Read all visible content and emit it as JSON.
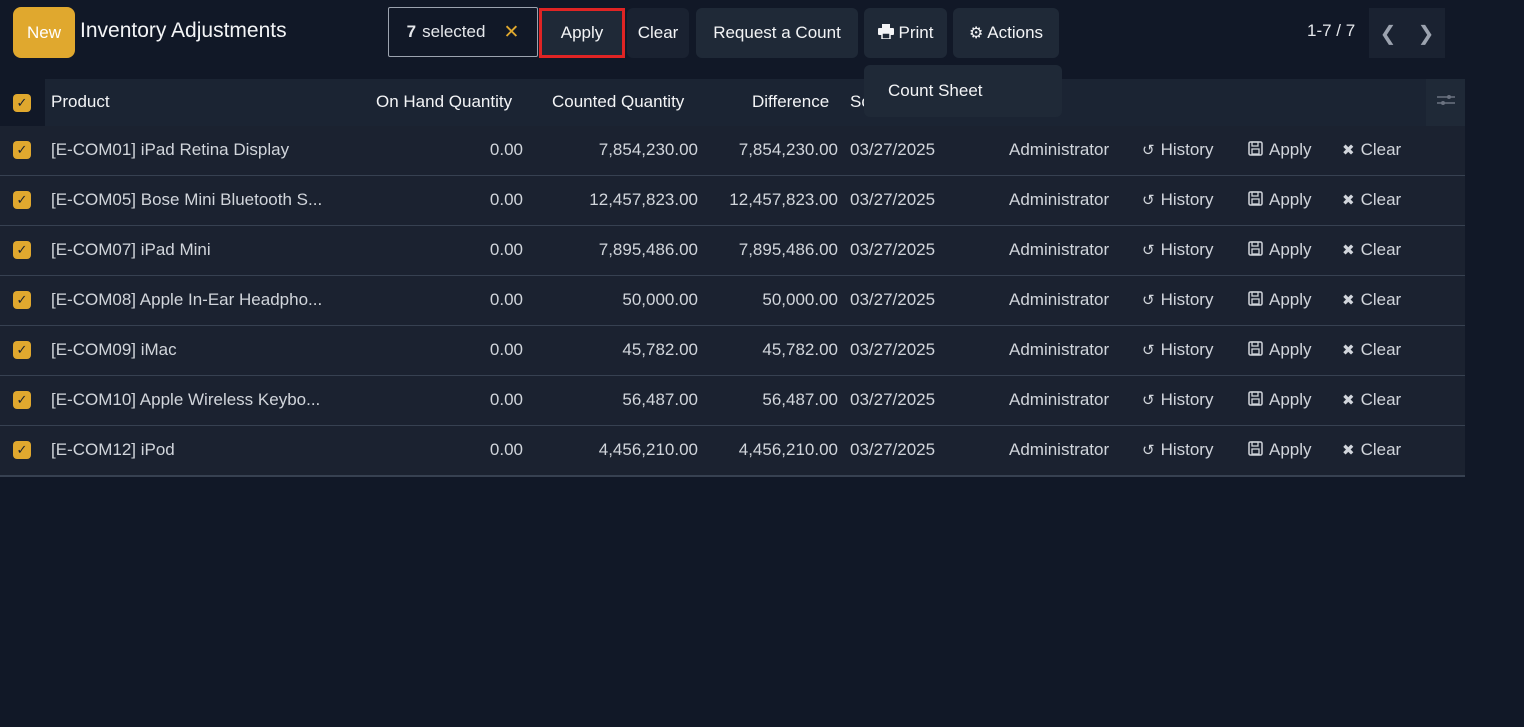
{
  "header": {
    "new_label": "New",
    "title": "Inventory Adjustments",
    "selected_count": "7",
    "selected_suffix": "selected",
    "clear_x": "✕",
    "apply_label": "Apply",
    "clear_label": "Clear",
    "request_label": "Request a Count",
    "print_label": "Print",
    "actions_label": "Actions",
    "pager_text": "1-7 / 7"
  },
  "dropdown": {
    "item": "Count Sheet"
  },
  "table": {
    "columns": {
      "product": "Product",
      "on_hand": "On Hand Quantity",
      "counted": "Counted Quantity",
      "difference": "Difference",
      "scheduled": "Sc"
    },
    "row_actions": {
      "history": "History",
      "apply": "Apply",
      "clear": "Clear"
    },
    "rows": [
      {
        "product": "[E-COM01] iPad Retina Display",
        "on_hand": "0.00",
        "counted": "7,854,230.00",
        "difference": "7,854,230.00",
        "date": "03/27/2025",
        "user": "Administrator"
      },
      {
        "product": "[E-COM05] Bose Mini Bluetooth S...",
        "on_hand": "0.00",
        "counted": "12,457,823.00",
        "difference": "12,457,823.00",
        "date": "03/27/2025",
        "user": "Administrator"
      },
      {
        "product": "[E-COM07] iPad Mini",
        "on_hand": "0.00",
        "counted": "7,895,486.00",
        "difference": "7,895,486.00",
        "date": "03/27/2025",
        "user": "Administrator"
      },
      {
        "product": "[E-COM08] Apple In-Ear Headpho...",
        "on_hand": "0.00",
        "counted": "50,000.00",
        "difference": "50,000.00",
        "date": "03/27/2025",
        "user": "Administrator"
      },
      {
        "product": "[E-COM09] iMac",
        "on_hand": "0.00",
        "counted": "45,782.00",
        "difference": "45,782.00",
        "date": "03/27/2025",
        "user": "Administrator"
      },
      {
        "product": "[E-COM10] Apple Wireless Keybo...",
        "on_hand": "0.00",
        "counted": "56,487.00",
        "difference": "56,487.00",
        "date": "03/27/2025",
        "user": "Administrator"
      },
      {
        "product": "[E-COM12] iPod",
        "on_hand": "0.00",
        "counted": "4,456,210.00",
        "difference": "4,456,210.00",
        "date": "03/27/2025",
        "user": "Administrator"
      }
    ]
  },
  "colors": {
    "accent": "#e0a82e",
    "highlight": "#e02424",
    "background": "#111827"
  }
}
